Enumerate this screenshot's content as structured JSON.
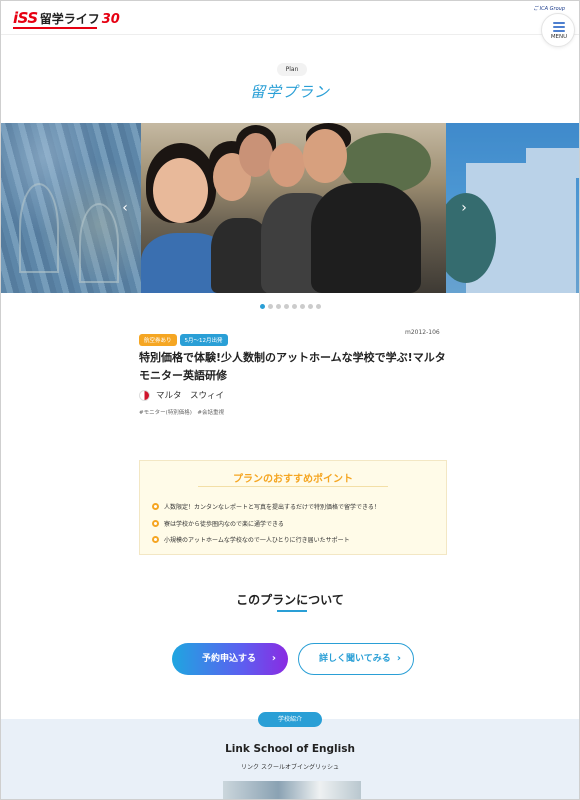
{
  "header": {
    "logo_iss": "iSS",
    "logo_text": "留学ライフ",
    "logo_years": "30",
    "group_label": "ご ICA Group",
    "menu_label": "MENU"
  },
  "hero": {
    "plan_label": "Plan",
    "title": "留学プラン",
    "slides_total": 8,
    "active_slide": 1
  },
  "plan": {
    "tags": [
      "航空券あり",
      "5月〜12月出発"
    ],
    "code": "m2012-106",
    "title": "特別価格で体験!少人数制のアットホームな学校で学ぶ!マルタ モニター英語研修",
    "country": "マルタ　スウィイ",
    "hashtags": "#モニター(特別価格)　#会話重視"
  },
  "points": {
    "title": "プランのおすすめポイント",
    "items": [
      "人数限定！カンタンなレポートと写真を提出するだけで特別価格で留学できる！",
      "寮は学校から徒歩圏内なので楽に通学できる",
      "小規模のアットホームな学校なので一人ひとりに行き届いたサポート"
    ]
  },
  "about": {
    "title": "このプランについて",
    "apply_button": "予約申込する",
    "ask_button": "詳しく聞いてみる"
  },
  "school": {
    "section_label": "学校紹介",
    "name": "Link School of English",
    "kana": "リンク スクールオブイングリッシュ"
  },
  "colors": {
    "accent": "#2a9fd6",
    "brand_red": "#e60012",
    "point_orange": "#f5a623"
  }
}
